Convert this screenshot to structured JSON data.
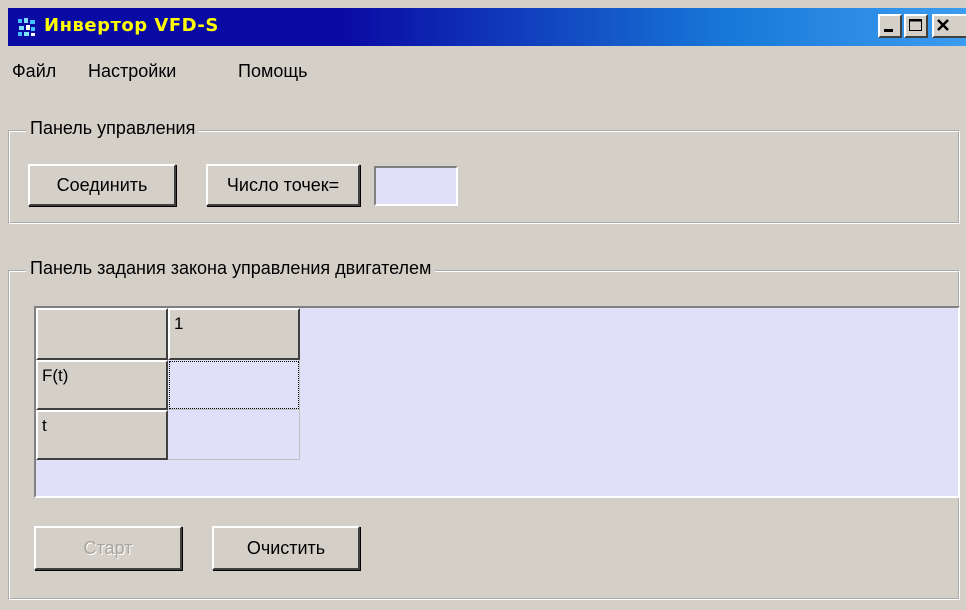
{
  "window": {
    "title": "Инвертор VFD-S",
    "icon": "app-icon",
    "controls": [
      "minimize-icon",
      "maximize-icon",
      "close-icon"
    ]
  },
  "menu": {
    "items": [
      "Файл",
      "Настройки",
      "Помощь"
    ]
  },
  "control_panel": {
    "legend": "Панель управления",
    "connect_label": "Соединить",
    "points_label": "Число точек=",
    "points_value": ""
  },
  "law_panel": {
    "legend": "Панель задания закона управления двигателем",
    "grid": {
      "columns": [
        "",
        "1"
      ],
      "rows": [
        {
          "label": "F(t)",
          "values": [
            ""
          ]
        },
        {
          "label": "t",
          "values": [
            ""
          ]
        }
      ]
    },
    "start_label": "Старт",
    "clear_label": "Очистить"
  },
  "colors": {
    "face": "#d4d0c8",
    "title_start": "#0a0aa4",
    "title_end": "#3c9cf0",
    "title_text": "#ffff00",
    "field": "#e0e0f8"
  }
}
